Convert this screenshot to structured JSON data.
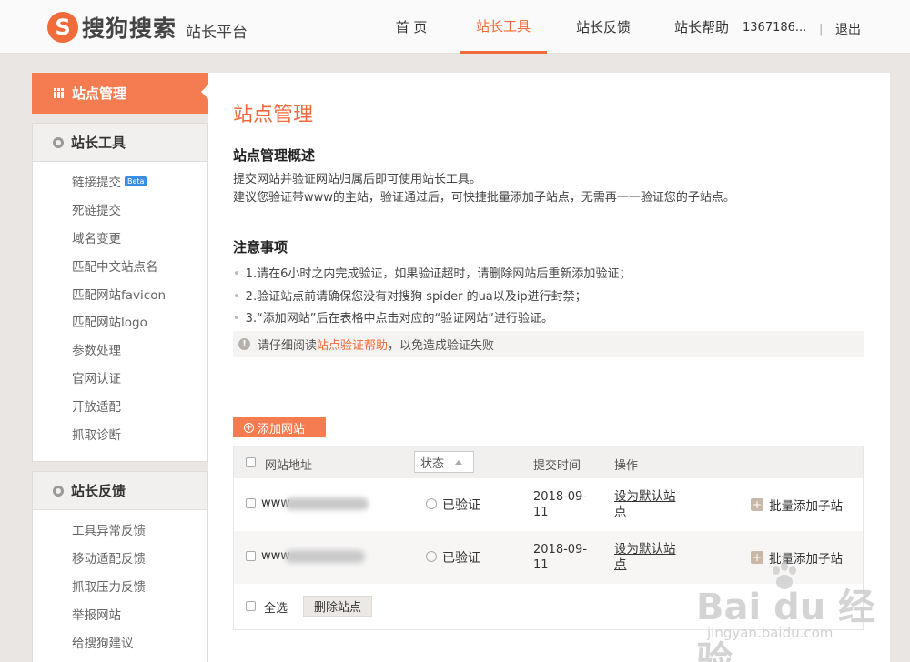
{
  "header": {
    "logo_mark": "S",
    "logo_text": "搜狗搜索",
    "logo_sub": "站长平台",
    "nav": [
      {
        "label": "首 页",
        "active": false
      },
      {
        "label": "站长工具",
        "active": true
      },
      {
        "label": "站长反馈",
        "active": false
      },
      {
        "label": "站长帮助",
        "active": false
      }
    ],
    "user": "1367186...",
    "separator": "|",
    "logout": "退出"
  },
  "sidebar": {
    "active_item": "站点管理",
    "tools": {
      "title": "站长工具",
      "items": [
        "链接提交",
        "死链提交",
        "域名变更",
        "匹配中文站点名",
        "匹配网站favicon",
        "匹配网站logo",
        "参数处理",
        "官网认证",
        "开放适配",
        "抓取诊断"
      ],
      "beta_label": "Beta"
    },
    "feedback": {
      "title": "站长反馈",
      "items": [
        "工具异常反馈",
        "移动适配反馈",
        "抓取压力反馈",
        "举报网站",
        "给搜狗建议"
      ]
    }
  },
  "main": {
    "title": "站点管理",
    "overview_title": "站点管理概述",
    "overview_lines": [
      "提交网站并验证网站归属后即可使用站长工具。",
      "建议您验证带www的主站，验证通过后，可快捷批量添加子站点，无需再一一验证您的子站点。"
    ],
    "notes_title": "注意事项",
    "notes": [
      "1.请在6小时之内完成验证，如果验证超时，请删除网站后重新添加验证；",
      "2.验证站点前请确保您没有对搜狗 spider 的ua以及ip进行封禁；",
      "3.“添加网站”后在表格中点击对应的“验证网站”进行验证。"
    ],
    "notice_prefix": "请仔细阅读",
    "notice_link": "站点验证帮助",
    "notice_suffix": "，以免造成验证失败",
    "add_button": "添加网站",
    "table": {
      "headers": {
        "site": "网站地址",
        "status": "状态",
        "time": "提交时间",
        "action": "操作"
      },
      "rows": [
        {
          "site": "www",
          "status": "已验证",
          "date_line1": "2018-09-",
          "date_line2": "11",
          "set_default_line1": "设为默认站",
          "set_default_line2": "点",
          "batch": "批量添加子站"
        },
        {
          "site": "www",
          "status": "已验证",
          "date_line1": "2018-09-",
          "date_line2": "11",
          "set_default_line1": "设为默认站",
          "set_default_line2": "点",
          "batch": "批量添加子站"
        }
      ],
      "select_all": "全选",
      "delete_button": "删除站点"
    }
  },
  "watermark": {
    "main": "Bai du 经验",
    "sub": "jingyan.baidu.com"
  },
  "colors": {
    "accent": "#f26b3a",
    "sidebar_active": "#f47c50",
    "background": "#e9e6e3"
  }
}
